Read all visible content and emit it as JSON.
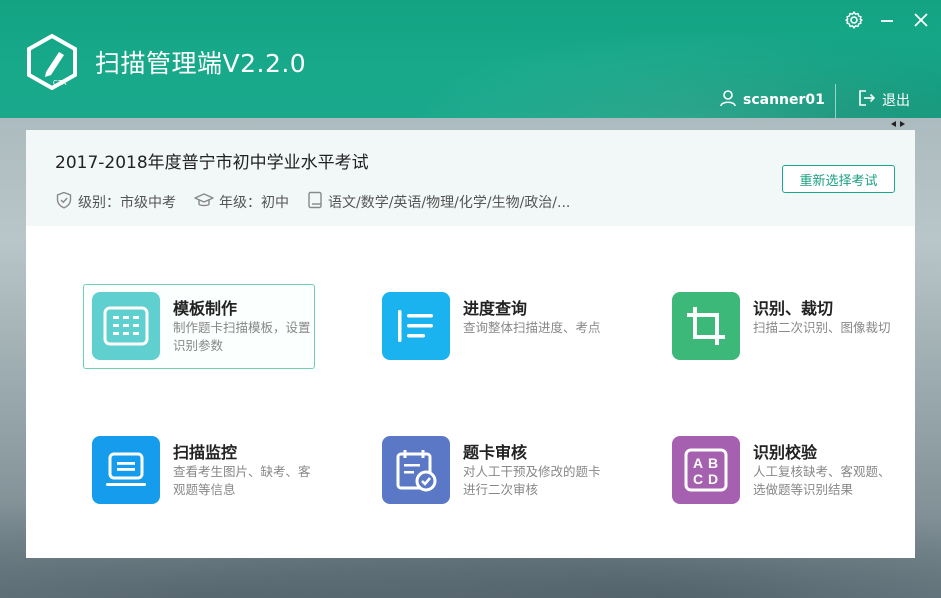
{
  "app": {
    "title": "扫描管理端V2.2.0",
    "logo_text": "CTA"
  },
  "window_controls": {
    "settings_icon": "gear-icon",
    "minimize_icon": "minimize-icon",
    "close_icon": "close-icon"
  },
  "user": {
    "name": "scanner01",
    "icon": "user-icon"
  },
  "logout": {
    "label": "退出",
    "icon": "logout-icon"
  },
  "exam": {
    "title": "2017-2018年度普宁市初中学业水平考试",
    "level_label": "级别：市级中考",
    "grade_label": "年级：初中",
    "subjects_label": "语文/数学/英语/物理/化学/生物/政治/...",
    "reselect_button": "重新选择考试"
  },
  "features": [
    {
      "title": "模板制作",
      "desc": "制作题卡扫描模板，设置识别参数",
      "icon": "grid-template-icon",
      "color": "#5fcfcf"
    },
    {
      "title": "进度查询",
      "desc": "查询整体扫描进度、考点",
      "icon": "list-progress-icon",
      "color": "#1ab2ef"
    },
    {
      "title": "识别、裁切",
      "desc": "扫描二次识别、图像裁切",
      "icon": "crop-icon",
      "color": "#3cb878"
    },
    {
      "title": "扫描监控",
      "desc": "查看考生图片、缺考、客观题等信息",
      "icon": "monitor-icon",
      "color": "#159cec"
    },
    {
      "title": "题卡审核",
      "desc": "对人工干预及修改的题卡进行二次审核",
      "icon": "calendar-check-icon",
      "color": "#5b78c7"
    },
    {
      "title": "识别校验",
      "desc": "人工复核缺考、客观题、选做题等识别结果",
      "icon": "abcd-icon",
      "color": "#a560b0"
    }
  ],
  "colors": {
    "brand": "#17a98a",
    "accent_border": "#6fd0a9"
  }
}
